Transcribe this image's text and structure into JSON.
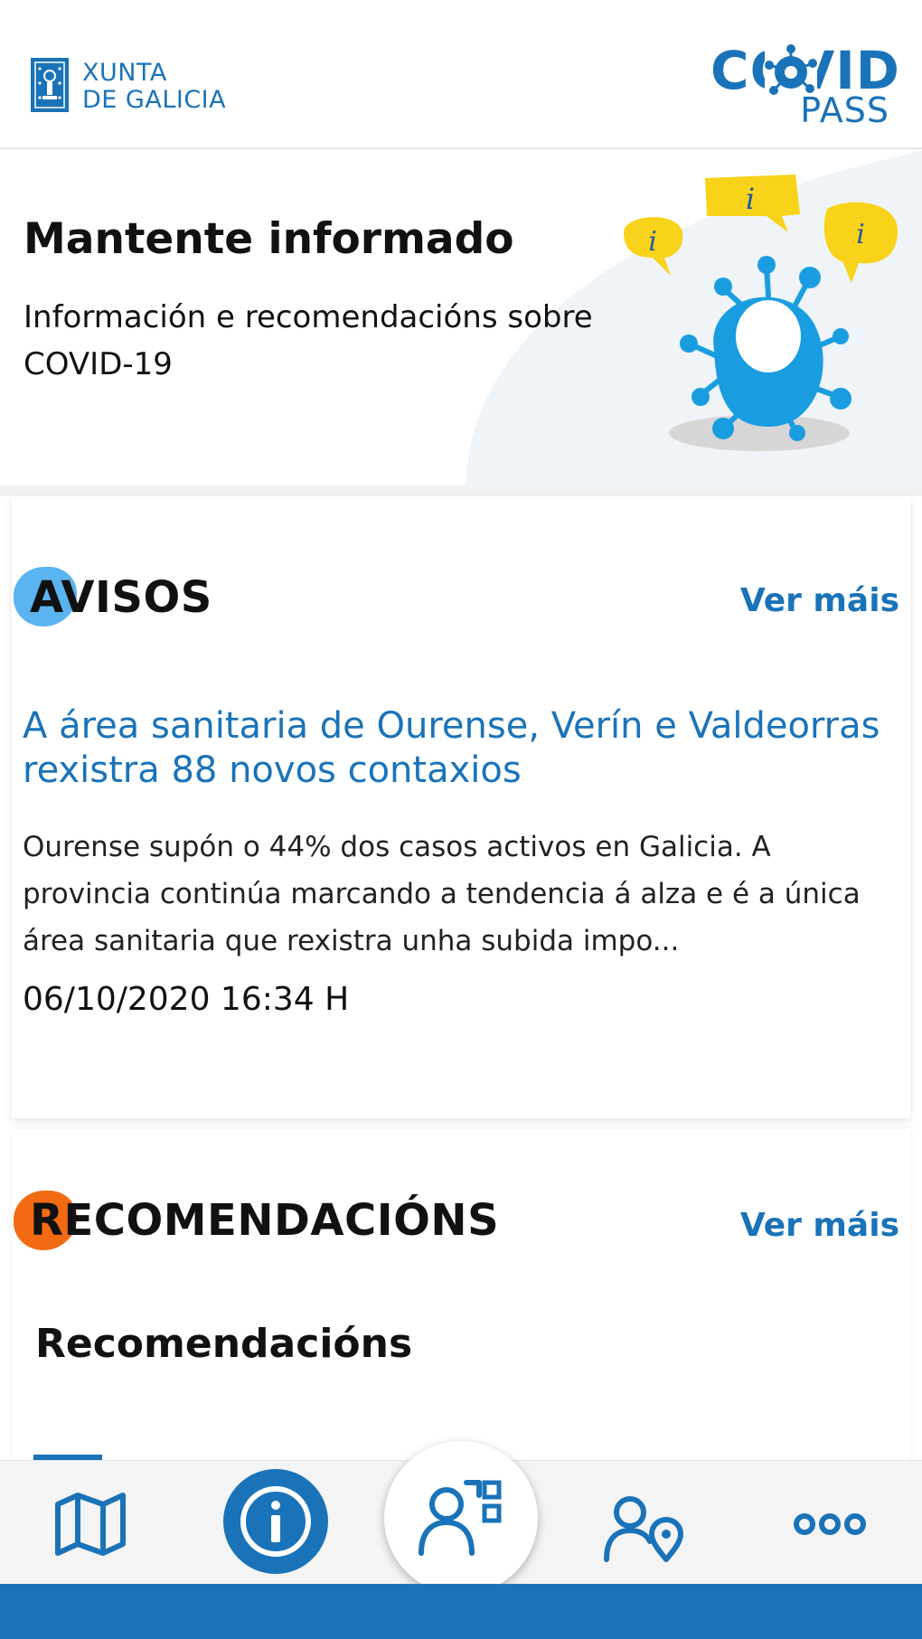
{
  "header": {
    "org_line1": "XUNTA",
    "org_line2": "DE GALICIA",
    "app_name_main": "COVID",
    "app_name_sub": "PASS"
  },
  "hero": {
    "title": "Mantente informado",
    "subtitle": "Información e recomendacións sobre COVID-19"
  },
  "avisos": {
    "title": "AVISOS",
    "see_more": "Ver máis",
    "news": {
      "title": "A área sanitaria de Ourense, Verín e Valdeorras rexistra 88 novos contaxios",
      "body": "Ourense supón o 44% dos casos activos en Galicia. A provincia continúa marcando a tendencia á alza e é a única área sanitaria que rexistra unha subida impo...",
      "date": "06/10/2020 16:34 H"
    }
  },
  "recomendacions": {
    "title": "RECOMENDACIÓNS",
    "see_more": "Ver máis",
    "subtitle": "Recomendacións"
  },
  "bottom_nav": {
    "items": [
      {
        "icon": "map-icon"
      },
      {
        "icon": "info-icon"
      },
      {
        "icon": "person-qr-icon"
      },
      {
        "icon": "person-location-icon"
      },
      {
        "icon": "more-dots-icon"
      }
    ]
  },
  "colors": {
    "primary": "#1a73b8",
    "avisos_accent": "#5ab4ef",
    "recom_accent": "#f26b12",
    "hero_bg_shape": "#eef4f8",
    "bubble_yellow": "#f9d21a"
  }
}
